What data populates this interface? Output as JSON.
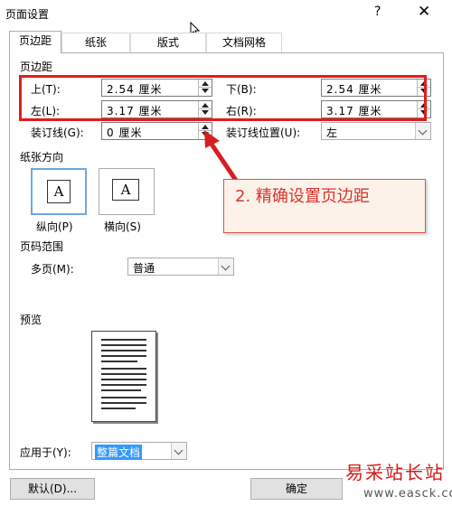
{
  "window": {
    "title": "页面设置",
    "help_glyph": "?",
    "close_glyph": "✕"
  },
  "tabs": [
    {
      "label": "页边距",
      "active": true
    },
    {
      "label": "纸张",
      "active": false
    },
    {
      "label": "版式",
      "active": false
    },
    {
      "label": "文档网格",
      "active": false
    }
  ],
  "margins": {
    "section_label": "页边距",
    "top": {
      "label": "上(T):",
      "value": "2.54 厘米"
    },
    "bottom": {
      "label": "下(B):",
      "value": "2.54 厘米"
    },
    "left": {
      "label": "左(L):",
      "value": "3.17 厘米"
    },
    "right": {
      "label": "右(R):",
      "value": "3.17 厘米"
    },
    "gutter": {
      "label": "装订线(G):",
      "value": "0 厘米"
    },
    "gutter_position": {
      "label": "装订线位置(U):",
      "value": "左"
    }
  },
  "orientation": {
    "section_label": "纸张方向",
    "portrait": {
      "label": "纵向(P)",
      "icon_text": "A",
      "selected": true
    },
    "landscape": {
      "label": "横向(S)",
      "icon_text": "A",
      "selected": false
    }
  },
  "pages": {
    "section_label": "页码范围",
    "multiple_label": "多页(M):",
    "multiple_value": "普通"
  },
  "preview": {
    "section_label": "预览"
  },
  "apply_to": {
    "label": "应用于(Y):",
    "value": "整篇文档"
  },
  "buttons": {
    "default_label": "默认(D)...",
    "ok_label": "确定"
  },
  "annotation": {
    "text": "2. 精确设置页边距",
    "color": "#e31b1b"
  },
  "watermark": {
    "text": "易采站长站",
    "url": "www.easck.com"
  }
}
